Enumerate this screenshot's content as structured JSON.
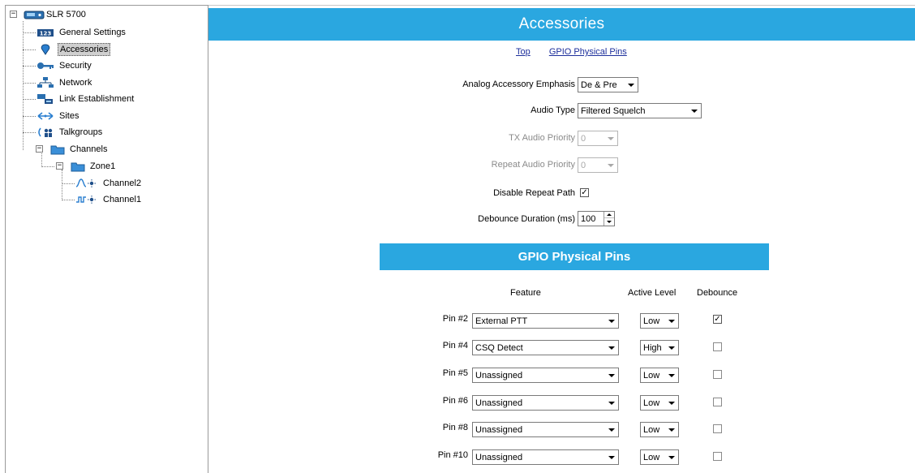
{
  "tree": {
    "root": "SLR 5700",
    "items": [
      {
        "label": "General Settings",
        "icon": "general-settings-icon"
      },
      {
        "label": "Accessories",
        "icon": "accessories-icon",
        "selected": true
      },
      {
        "label": "Security",
        "icon": "key-icon"
      },
      {
        "label": "Network",
        "icon": "network-icon"
      },
      {
        "label": "Link Establishment",
        "icon": "link-establishment-icon"
      },
      {
        "label": "Sites",
        "icon": "sites-icon"
      },
      {
        "label": "Talkgroups",
        "icon": "talkgroups-icon"
      },
      {
        "label": "Channels",
        "icon": "folder-icon"
      }
    ],
    "zone": "Zone1",
    "channels": [
      "Channel2",
      "Channel1"
    ]
  },
  "page": {
    "title": "Accessories",
    "links": [
      "Top",
      "GPIO Physical Pins"
    ]
  },
  "form": {
    "analog_emphasis": {
      "label": "Analog Accessory Emphasis",
      "value": "De & Pre"
    },
    "audio_type": {
      "label": "Audio Type",
      "value": "Filtered Squelch"
    },
    "tx_audio_priority": {
      "label": "TX Audio Priority",
      "value": "0",
      "disabled": true
    },
    "repeat_audio_priority": {
      "label": "Repeat Audio Priority",
      "value": "0",
      "disabled": true
    },
    "disable_repeat_path": {
      "label": "Disable Repeat Path",
      "checked": true
    },
    "debounce_duration": {
      "label": "Debounce Duration (ms)",
      "value": "100"
    }
  },
  "gpio": {
    "title": "GPIO Physical Pins",
    "headers": {
      "feature": "Feature",
      "active_level": "Active Level",
      "debounce": "Debounce"
    },
    "pins": [
      {
        "pin": "Pin #2",
        "feature": "External PTT",
        "level": "Low",
        "debounce": true
      },
      {
        "pin": "Pin #4",
        "feature": "CSQ Detect",
        "level": "High",
        "debounce": false
      },
      {
        "pin": "Pin #5",
        "feature": "Unassigned",
        "level": "Low",
        "debounce": false
      },
      {
        "pin": "Pin #6",
        "feature": "Unassigned",
        "level": "Low",
        "debounce": false
      },
      {
        "pin": "Pin #8",
        "feature": "Unassigned",
        "level": "Low",
        "debounce": false
      },
      {
        "pin": "Pin #10",
        "feature": "Unassigned",
        "level": "Low",
        "debounce": false
      }
    ]
  },
  "colors": {
    "banner": "#2aa7e0",
    "link": "#1d2f9c",
    "selection": "#cfcfcf"
  }
}
